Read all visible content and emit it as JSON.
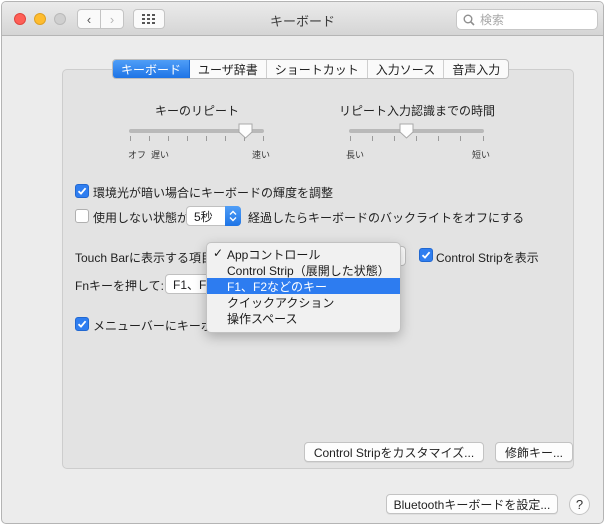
{
  "window": {
    "title": "キーボード"
  },
  "toolbar": {
    "back_glyph": "‹",
    "forward_glyph": "›"
  },
  "search": {
    "placeholder": "検索"
  },
  "tabs": [
    {
      "label": "キーボード",
      "active": true
    },
    {
      "label": "ユーザ辞書",
      "active": false
    },
    {
      "label": "ショートカット",
      "active": false
    },
    {
      "label": "入力ソース",
      "active": false
    },
    {
      "label": "音声入力",
      "active": false
    }
  ],
  "key_repeat": {
    "label": "キーのリピート",
    "min_label_off": "オフ",
    "min_label_slow": "遅い",
    "max_label": "速い",
    "level": 0.86
  },
  "repeat_delay": {
    "label": "リピート入力認識までの時間",
    "min_label": "長い",
    "max_label": "短い",
    "level": 0.42
  },
  "settings": {
    "ambient_light": {
      "label": "環境光が暗い場合にキーボードの輝度を調整",
      "checked": true
    },
    "backlight_off": {
      "label_before": "使用しない状態が",
      "value": "5秒",
      "label_after": "経過したらキーボードのバックライトをオフにする",
      "checked": false
    },
    "touch_bar": {
      "label": "Touch Barに表示する項目"
    },
    "control_strip": {
      "label": "Control Stripを表示",
      "checked": true
    },
    "fn_key": {
      "label": "Fnキーを押して:",
      "value": "F1、F2"
    },
    "menu_bar": {
      "label": "メニューバーにキーボー",
      "checked": true
    }
  },
  "dropdown_menu": {
    "check_glyph": "✓",
    "items": [
      {
        "label": "Appコントロール",
        "checked": true,
        "highlighted": false
      },
      {
        "label": "Control Strip（展開した状態）",
        "checked": false,
        "highlighted": false
      },
      {
        "label": "F1、F2などのキー",
        "checked": false,
        "highlighted": true
      },
      {
        "label": "クイックアクション",
        "checked": false,
        "highlighted": false
      },
      {
        "label": "操作スペース",
        "checked": false,
        "highlighted": false
      }
    ]
  },
  "buttons": {
    "customize_control_strip": "Control Stripをカスタマイズ...",
    "modifier_keys": "修飾キー...",
    "bluetooth_setup": "Bluetoothキーボードを設定...",
    "help": "?"
  },
  "colors": {
    "accent": "#2d7cf0",
    "close": "#fe5f57",
    "minimize": "#febc2e"
  }
}
